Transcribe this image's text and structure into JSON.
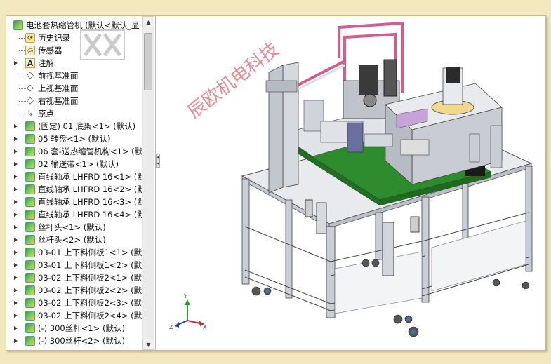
{
  "tree": {
    "root": "电池套热缩管机 (默认<默认_显",
    "items": [
      {
        "label": "历史记录",
        "icon": "history-icon",
        "expand": false
      },
      {
        "label": "传感器",
        "icon": "sensor-icon",
        "expand": false
      },
      {
        "label": "注解",
        "icon": "annotation-icon",
        "expand": true
      },
      {
        "label": "前视基准面",
        "icon": "plane-icon",
        "expand": false
      },
      {
        "label": "上视基准面",
        "icon": "plane-icon",
        "expand": false
      },
      {
        "label": "右视基准面",
        "icon": "plane-icon",
        "expand": false
      },
      {
        "label": "原点",
        "icon": "origin-icon",
        "expand": false
      },
      {
        "label": "(固定) 01 底架<1> (默认)",
        "icon": "part-icon",
        "expand": true
      },
      {
        "label": "05 转盘<1> (默认)",
        "icon": "part-icon",
        "expand": true
      },
      {
        "label": "06 套-送热缩管机构<1> (默",
        "icon": "part-icon",
        "expand": true
      },
      {
        "label": "02 输送带<1> (默认)",
        "icon": "part-icon",
        "expand": true
      },
      {
        "label": "直线轴承 LHFRD 16<1> (默",
        "icon": "part-icon",
        "expand": true
      },
      {
        "label": "直线轴承 LHFRD 16<2> (默",
        "icon": "part-icon",
        "expand": true
      },
      {
        "label": "直线轴承 LHFRD 16<3> (默",
        "icon": "part-icon",
        "expand": true
      },
      {
        "label": "直线轴承 LHFRD 16<4> (默",
        "icon": "part-icon",
        "expand": true
      },
      {
        "label": "丝杆头<1> (默认)",
        "icon": "part-icon",
        "expand": true
      },
      {
        "label": "丝杆头<2> (默认)",
        "icon": "part-icon",
        "expand": true
      },
      {
        "label": "03-01 上下料侧板1<1> (默",
        "icon": "part-icon",
        "expand": true
      },
      {
        "label": "03-01 上下料侧板1<2> (默",
        "icon": "part-icon",
        "expand": true
      },
      {
        "label": "03-02 上下料侧板2<1> (默",
        "icon": "part-icon",
        "expand": true
      },
      {
        "label": "03-02 上下料侧板2<2> (默",
        "icon": "part-icon",
        "expand": true
      },
      {
        "label": "03-02 上下料侧板2<3> (默",
        "icon": "part-icon",
        "expand": true
      },
      {
        "label": "03-02 上下料侧板2<4> (默",
        "icon": "part-icon",
        "expand": true
      },
      {
        "label": "(-) 300丝杆<1> (默认)",
        "icon": "part-icon",
        "expand": true
      },
      {
        "label": "(-) 300丝杆<2> (默认)",
        "icon": "part-icon",
        "expand": true
      }
    ]
  },
  "watermark": "辰欧机电科技",
  "triad": {
    "x": "X",
    "y": "Y",
    "z": "Z"
  },
  "colors": {
    "green": "#2e8b2e",
    "frame": "#c9ced6",
    "pink": "#d45c8a",
    "accent": "#3b9c3b"
  }
}
